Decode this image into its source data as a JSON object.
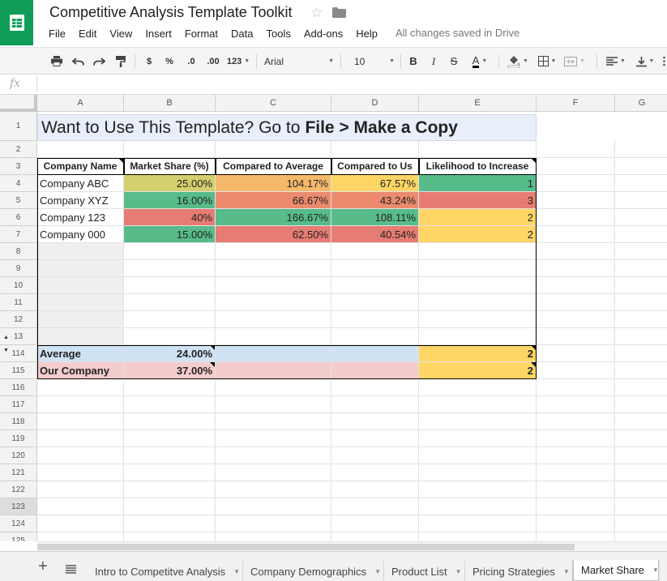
{
  "app": {
    "title": "Competitive Analysis Template Toolkit",
    "save_status": "All changes saved in Drive",
    "menu": [
      "File",
      "Edit",
      "View",
      "Insert",
      "Format",
      "Data",
      "Tools",
      "Add-ons",
      "Help"
    ]
  },
  "toolbar": {
    "currency": "$",
    "percent": "%",
    "decrease_decimals": ".0",
    "increase_decimals": ".00",
    "more_formats": "123",
    "font": "Arial",
    "font_size": "10",
    "bold": "B",
    "italic": "I",
    "strikethrough": "S",
    "text_color": "A",
    "icons": [
      "print-icon",
      "undo-icon",
      "redo-icon",
      "paint-format-icon",
      "fill-color-icon",
      "borders-icon",
      "merge-cells-icon",
      "align-icon",
      "valign-icon"
    ]
  },
  "formula_bar": {
    "fx": "fx",
    "value": ""
  },
  "columns": [
    "A",
    "B",
    "C",
    "D",
    "E",
    "F",
    "G"
  ],
  "rows": [
    "1",
    "2",
    "3",
    "4",
    "5",
    "6",
    "7",
    "8",
    "9",
    "10",
    "11",
    "12",
    "13",
    "114",
    "115",
    "116",
    "117",
    "118",
    "119",
    "120",
    "121",
    "122",
    "123",
    "124",
    "125"
  ],
  "sheet": {
    "banner": {
      "prefix": "Want to Use This Template? Go to",
      "bold": "File > Make a Copy"
    },
    "headers": [
      "Company Name",
      "Market Share (%)",
      "Compared to Average",
      "Compared to Us",
      "Likelihood to Increase"
    ],
    "companies": [
      {
        "name": "Company ABC",
        "share": "25.00%",
        "vs_avg": "104.17%",
        "vs_us": "67.57%",
        "likelihood": "1"
      },
      {
        "name": "Company XYZ",
        "share": "16.00%",
        "vs_avg": "66.67%",
        "vs_us": "43.24%",
        "likelihood": "3"
      },
      {
        "name": "Company 123",
        "share": "40%",
        "vs_avg": "166.67%",
        "vs_us": "108.11%",
        "likelihood": "2"
      },
      {
        "name": "Company 000",
        "share": "15.00%",
        "vs_avg": "62.50%",
        "vs_us": "40.54%",
        "likelihood": "2"
      }
    ],
    "average": {
      "label": "Average",
      "share": "24.00%",
      "likelihood": "2"
    },
    "our_company": {
      "label": "Our Company",
      "share": "37.00%",
      "likelihood": "2"
    }
  },
  "tabs": [
    {
      "label": "Intro to Competitve Analysis",
      "active": false
    },
    {
      "label": "Company Demographics",
      "active": false
    },
    {
      "label": "Product List",
      "active": false
    },
    {
      "label": "Pricing Strategies",
      "active": false
    },
    {
      "label": "Market Share",
      "active": true
    }
  ],
  "colors": {
    "brand": "#0f9d58",
    "green": "#57bb8a",
    "yellow": "#ffd666",
    "olive": "#d4cf6e",
    "orange": "#f6b96a",
    "salmon": "#ec8a6e",
    "red": "#e67c73",
    "light_blue": "#cfe2f3",
    "light_pink": "#f4cccc",
    "banner": "#e8eefa"
  }
}
